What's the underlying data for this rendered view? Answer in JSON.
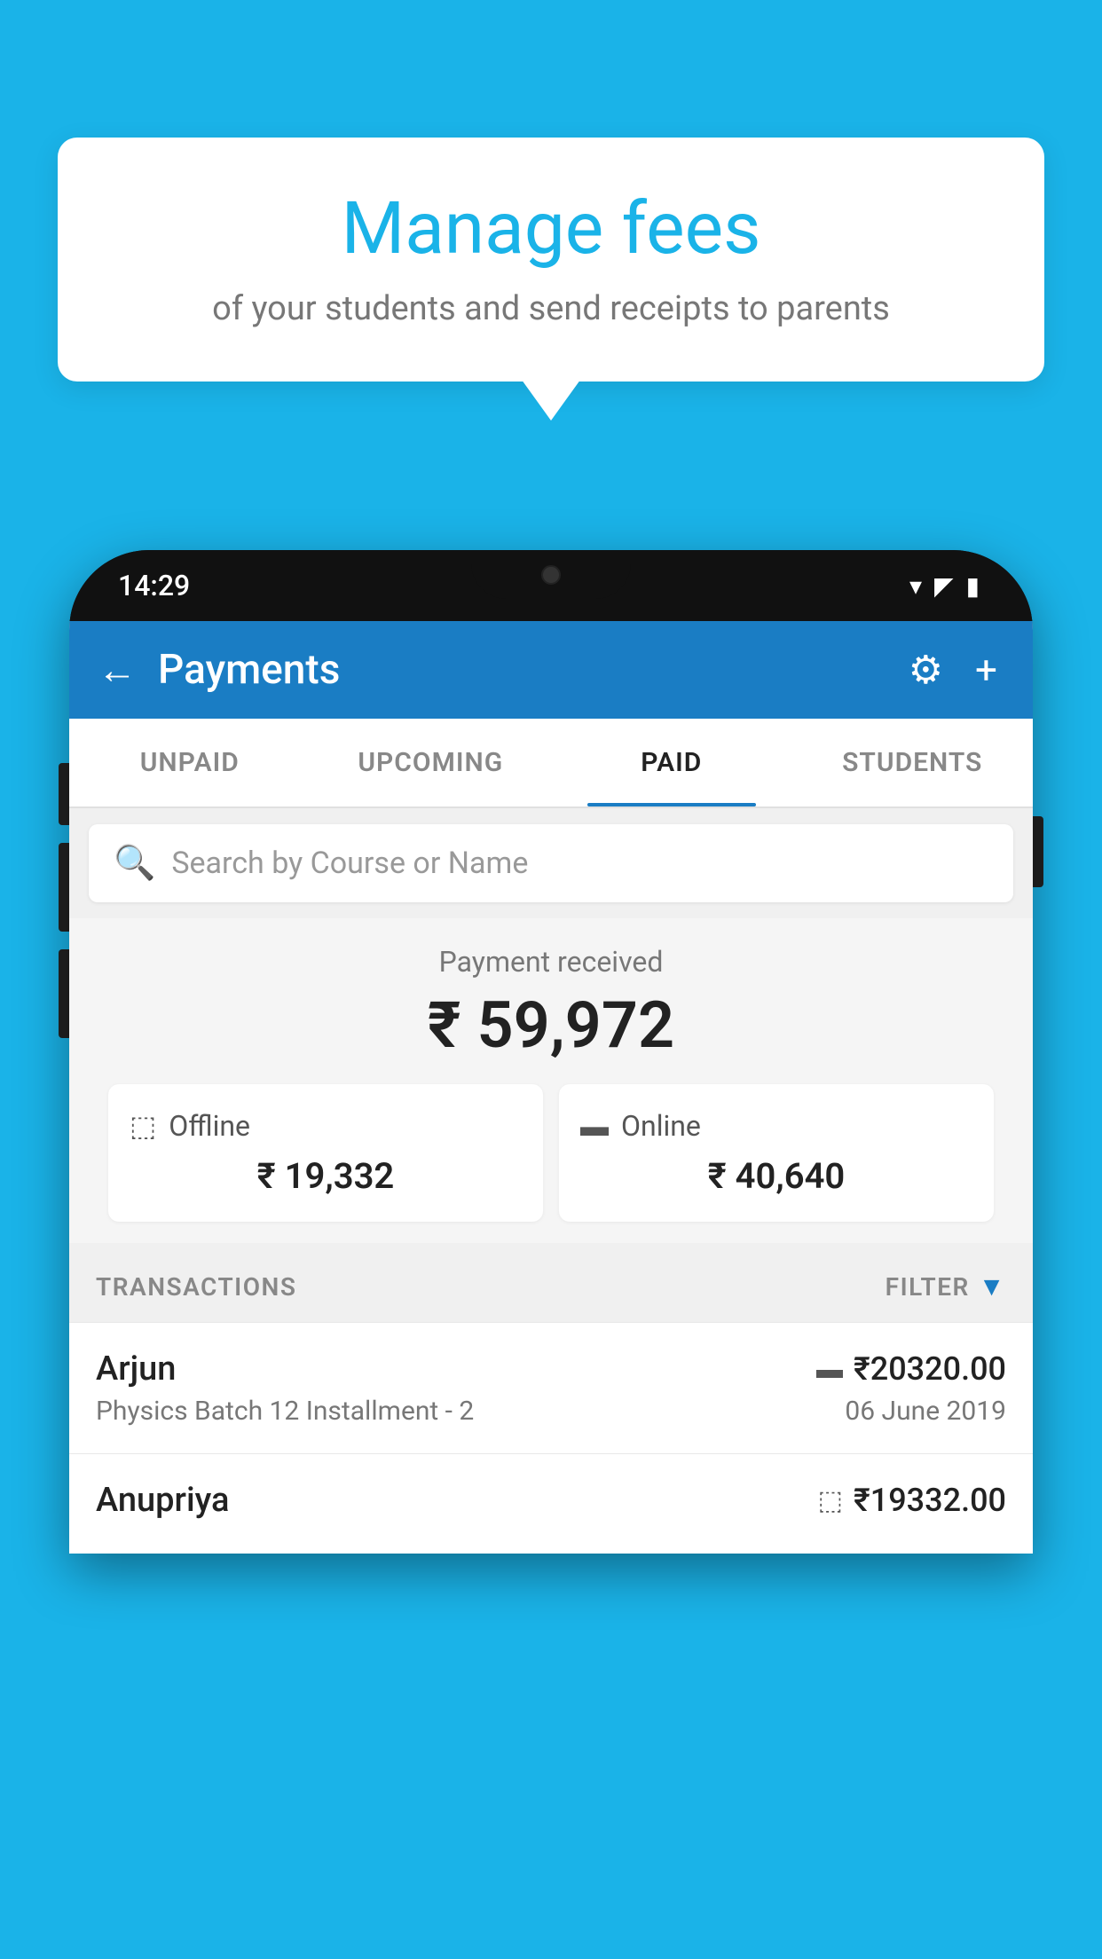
{
  "tooltip": {
    "title": "Manage fees",
    "subtitle": "of your students and send receipts to parents"
  },
  "phone": {
    "status_bar": {
      "time": "14:29",
      "wifi_icon": "▾",
      "signal_icon": "▲",
      "battery_icon": "▮"
    },
    "header": {
      "title": "Payments",
      "back_label": "←",
      "settings_label": "⚙",
      "add_label": "+"
    },
    "tabs": [
      {
        "label": "UNPAID",
        "active": false
      },
      {
        "label": "UPCOMING",
        "active": false
      },
      {
        "label": "PAID",
        "active": true
      },
      {
        "label": "STUDENTS",
        "active": false
      }
    ],
    "search": {
      "placeholder": "Search by Course or Name"
    },
    "payment_summary": {
      "label": "Payment received",
      "amount": "₹ 59,972",
      "offline_label": "Offline",
      "offline_amount": "₹ 19,332",
      "online_label": "Online",
      "online_amount": "₹ 40,640"
    },
    "transactions_section": {
      "header_label": "TRANSACTIONS",
      "filter_label": "FILTER"
    },
    "transactions": [
      {
        "name": "Arjun",
        "course": "Physics Batch 12 Installment - 2",
        "amount": "₹20320.00",
        "date": "06 June 2019",
        "type": "online"
      },
      {
        "name": "Anupriya",
        "course": "",
        "amount": "₹19332.00",
        "date": "",
        "type": "offline"
      }
    ]
  },
  "colors": {
    "primary_bg": "#1ab3e8",
    "app_header": "#1a7dc4",
    "white": "#ffffff",
    "text_dark": "#222222",
    "text_gray": "#777777",
    "text_light": "#999999",
    "accent": "#1a7dc4"
  }
}
